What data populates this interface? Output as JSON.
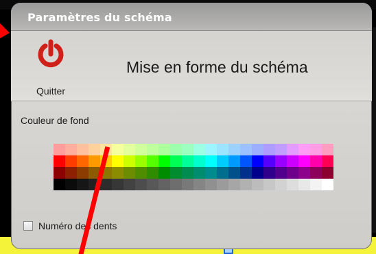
{
  "dialog": {
    "title": "Paramètres du schéma"
  },
  "header": {
    "quit_label": "Quitter",
    "quit_icon": "power-icon",
    "title": "Mise en forme du schéma",
    "accent": "#d0201a"
  },
  "background_color": {
    "label": "Couleur de fond",
    "palette_rows": [
      [
        "#ff9d9d",
        "#ffae9d",
        "#ffc09d",
        "#ffd29d",
        "#ffe49d",
        "#f6ff9d",
        "#e4ff9d",
        "#d2ff9d",
        "#c0ff9d",
        "#aeff9d",
        "#9dffae",
        "#9dffc0",
        "#9dffe4",
        "#9df6ff",
        "#9de4ff",
        "#9dd2ff",
        "#9dc0ff",
        "#9daeff",
        "#ae9dff",
        "#c09dff",
        "#e49dff",
        "#ff9df6",
        "#ff9de4",
        "#ff9dc0"
      ],
      [
        "#ff0000",
        "#ff3c00",
        "#ff6600",
        "#ff9900",
        "#ffcc00",
        "#ffff00",
        "#ccff00",
        "#99ff00",
        "#55ff00",
        "#00ff00",
        "#00ff55",
        "#00ff99",
        "#00ffcc",
        "#00ffff",
        "#00ccff",
        "#0099ff",
        "#0055ff",
        "#0000ff",
        "#5500ff",
        "#9900ff",
        "#cc00ff",
        "#ff00ff",
        "#ff00aa",
        "#ff0055"
      ],
      [
        "#8c0000",
        "#8c2000",
        "#8c3c00",
        "#8c5a00",
        "#8c7800",
        "#8c8c00",
        "#6e8c00",
        "#508c00",
        "#2f8c00",
        "#008c00",
        "#008c2f",
        "#008c50",
        "#008c6e",
        "#008c8c",
        "#006e8c",
        "#00508c",
        "#002f8c",
        "#00008c",
        "#2f008c",
        "#50008c",
        "#6e008c",
        "#8c008c",
        "#8c005a",
        "#8c002f"
      ],
      [
        "#000000",
        "#0b0b0b",
        "#161616",
        "#212121",
        "#2c2c2c",
        "#373737",
        "#424242",
        "#4d4d4d",
        "#585858",
        "#636363",
        "#6e6e6e",
        "#797979",
        "#858585",
        "#909090",
        "#9b9b9b",
        "#a6a6a6",
        "#b1b1b1",
        "#bcbcbc",
        "#c7c7c7",
        "#d2d2d2",
        "#dddddd",
        "#e8e8e8",
        "#f3f3f3",
        "#ffffff"
      ]
    ]
  },
  "options": {
    "teeth_numbers_label": "Numéro des dents",
    "teeth_numbers_checked": false
  },
  "annotation": {
    "color": "#ff0000"
  }
}
